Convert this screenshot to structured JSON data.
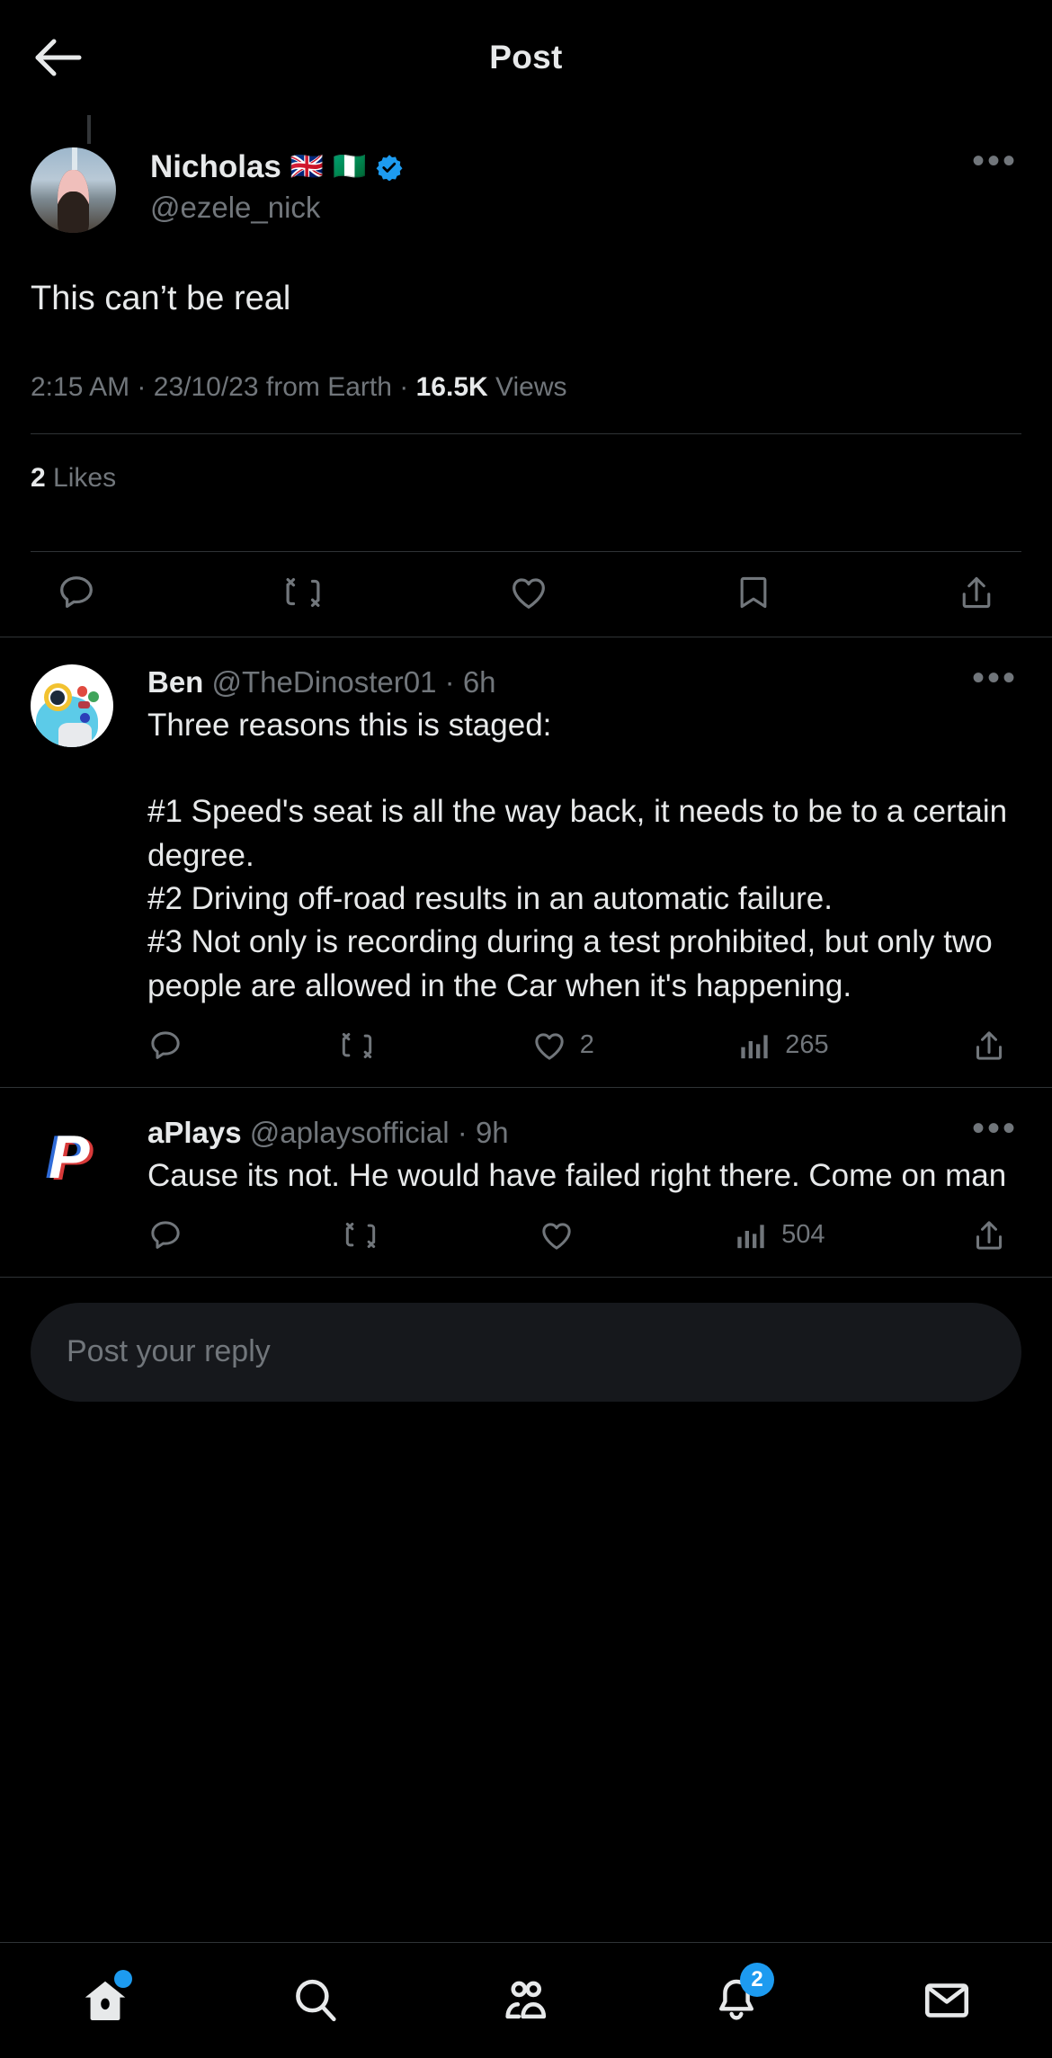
{
  "header": {
    "back_icon": "arrow-left-icon",
    "title": "Post"
  },
  "main_post": {
    "author": {
      "display_name": "Nicholas",
      "flags": [
        "🇬🇧",
        "🇳🇬"
      ],
      "verified": true,
      "handle": "@ezele_nick",
      "avatar": "nicholas-avatar"
    },
    "more_label": "•••",
    "text": "This can’t be real",
    "meta": {
      "time": "2:15 AM",
      "separator": "·",
      "date": "23/10/23 from Earth",
      "views_count": "16.5K",
      "views_label": "Views"
    },
    "likes": {
      "count": "2",
      "label": "Likes"
    },
    "actions": [
      {
        "name": "reply",
        "icon": "reply-icon",
        "count": ""
      },
      {
        "name": "repost",
        "icon": "repost-icon",
        "count": ""
      },
      {
        "name": "like",
        "icon": "heart-icon",
        "count": ""
      },
      {
        "name": "bookmark",
        "icon": "bookmark-icon",
        "count": ""
      },
      {
        "name": "share",
        "icon": "share-icon",
        "count": ""
      }
    ]
  },
  "replies": [
    {
      "display_name": "Ben",
      "handle": "@TheDinoster01",
      "time": "6h",
      "separator": "·",
      "more_label": "•••",
      "avatar": "ben-avatar",
      "text": "Three reasons this is staged:\n\n#1 Speed's seat is all the way back, it needs to be to a certain degree.\n#2 Driving off-road results in an automatic failure.\n#3 Not only is recording during a test prohibited, but only two people are allowed in the Car when it's happening.",
      "actions": {
        "reply_count": "",
        "repost_count": "",
        "like_count": "2",
        "views_count": "265"
      }
    },
    {
      "display_name": "aPlays",
      "handle": "@aplaysofficial",
      "time": "9h",
      "separator": "·",
      "more_label": "•••",
      "avatar": "aplays-avatar",
      "text": "Cause its not. He would have failed right there. Come on man",
      "actions": {
        "reply_count": "",
        "repost_count": "",
        "like_count": "",
        "views_count": "504"
      }
    }
  ],
  "composer": {
    "placeholder": "Post your reply",
    "value": ""
  },
  "bottom_nav": {
    "items": [
      {
        "name": "home",
        "icon": "home-icon",
        "dot": true,
        "badge": ""
      },
      {
        "name": "search",
        "icon": "search-icon",
        "dot": false,
        "badge": ""
      },
      {
        "name": "communities",
        "icon": "communities-icon",
        "dot": false,
        "badge": ""
      },
      {
        "name": "notifications",
        "icon": "bell-icon",
        "dot": false,
        "badge": "2"
      },
      {
        "name": "messages",
        "icon": "mail-icon",
        "dot": false,
        "badge": ""
      }
    ]
  },
  "colors": {
    "background": "#000000",
    "text_primary": "#e7e9ea",
    "text_secondary": "#71767b",
    "accent": "#1d9bf0",
    "divider": "#2f3336",
    "composer_bg": "#16181c"
  }
}
